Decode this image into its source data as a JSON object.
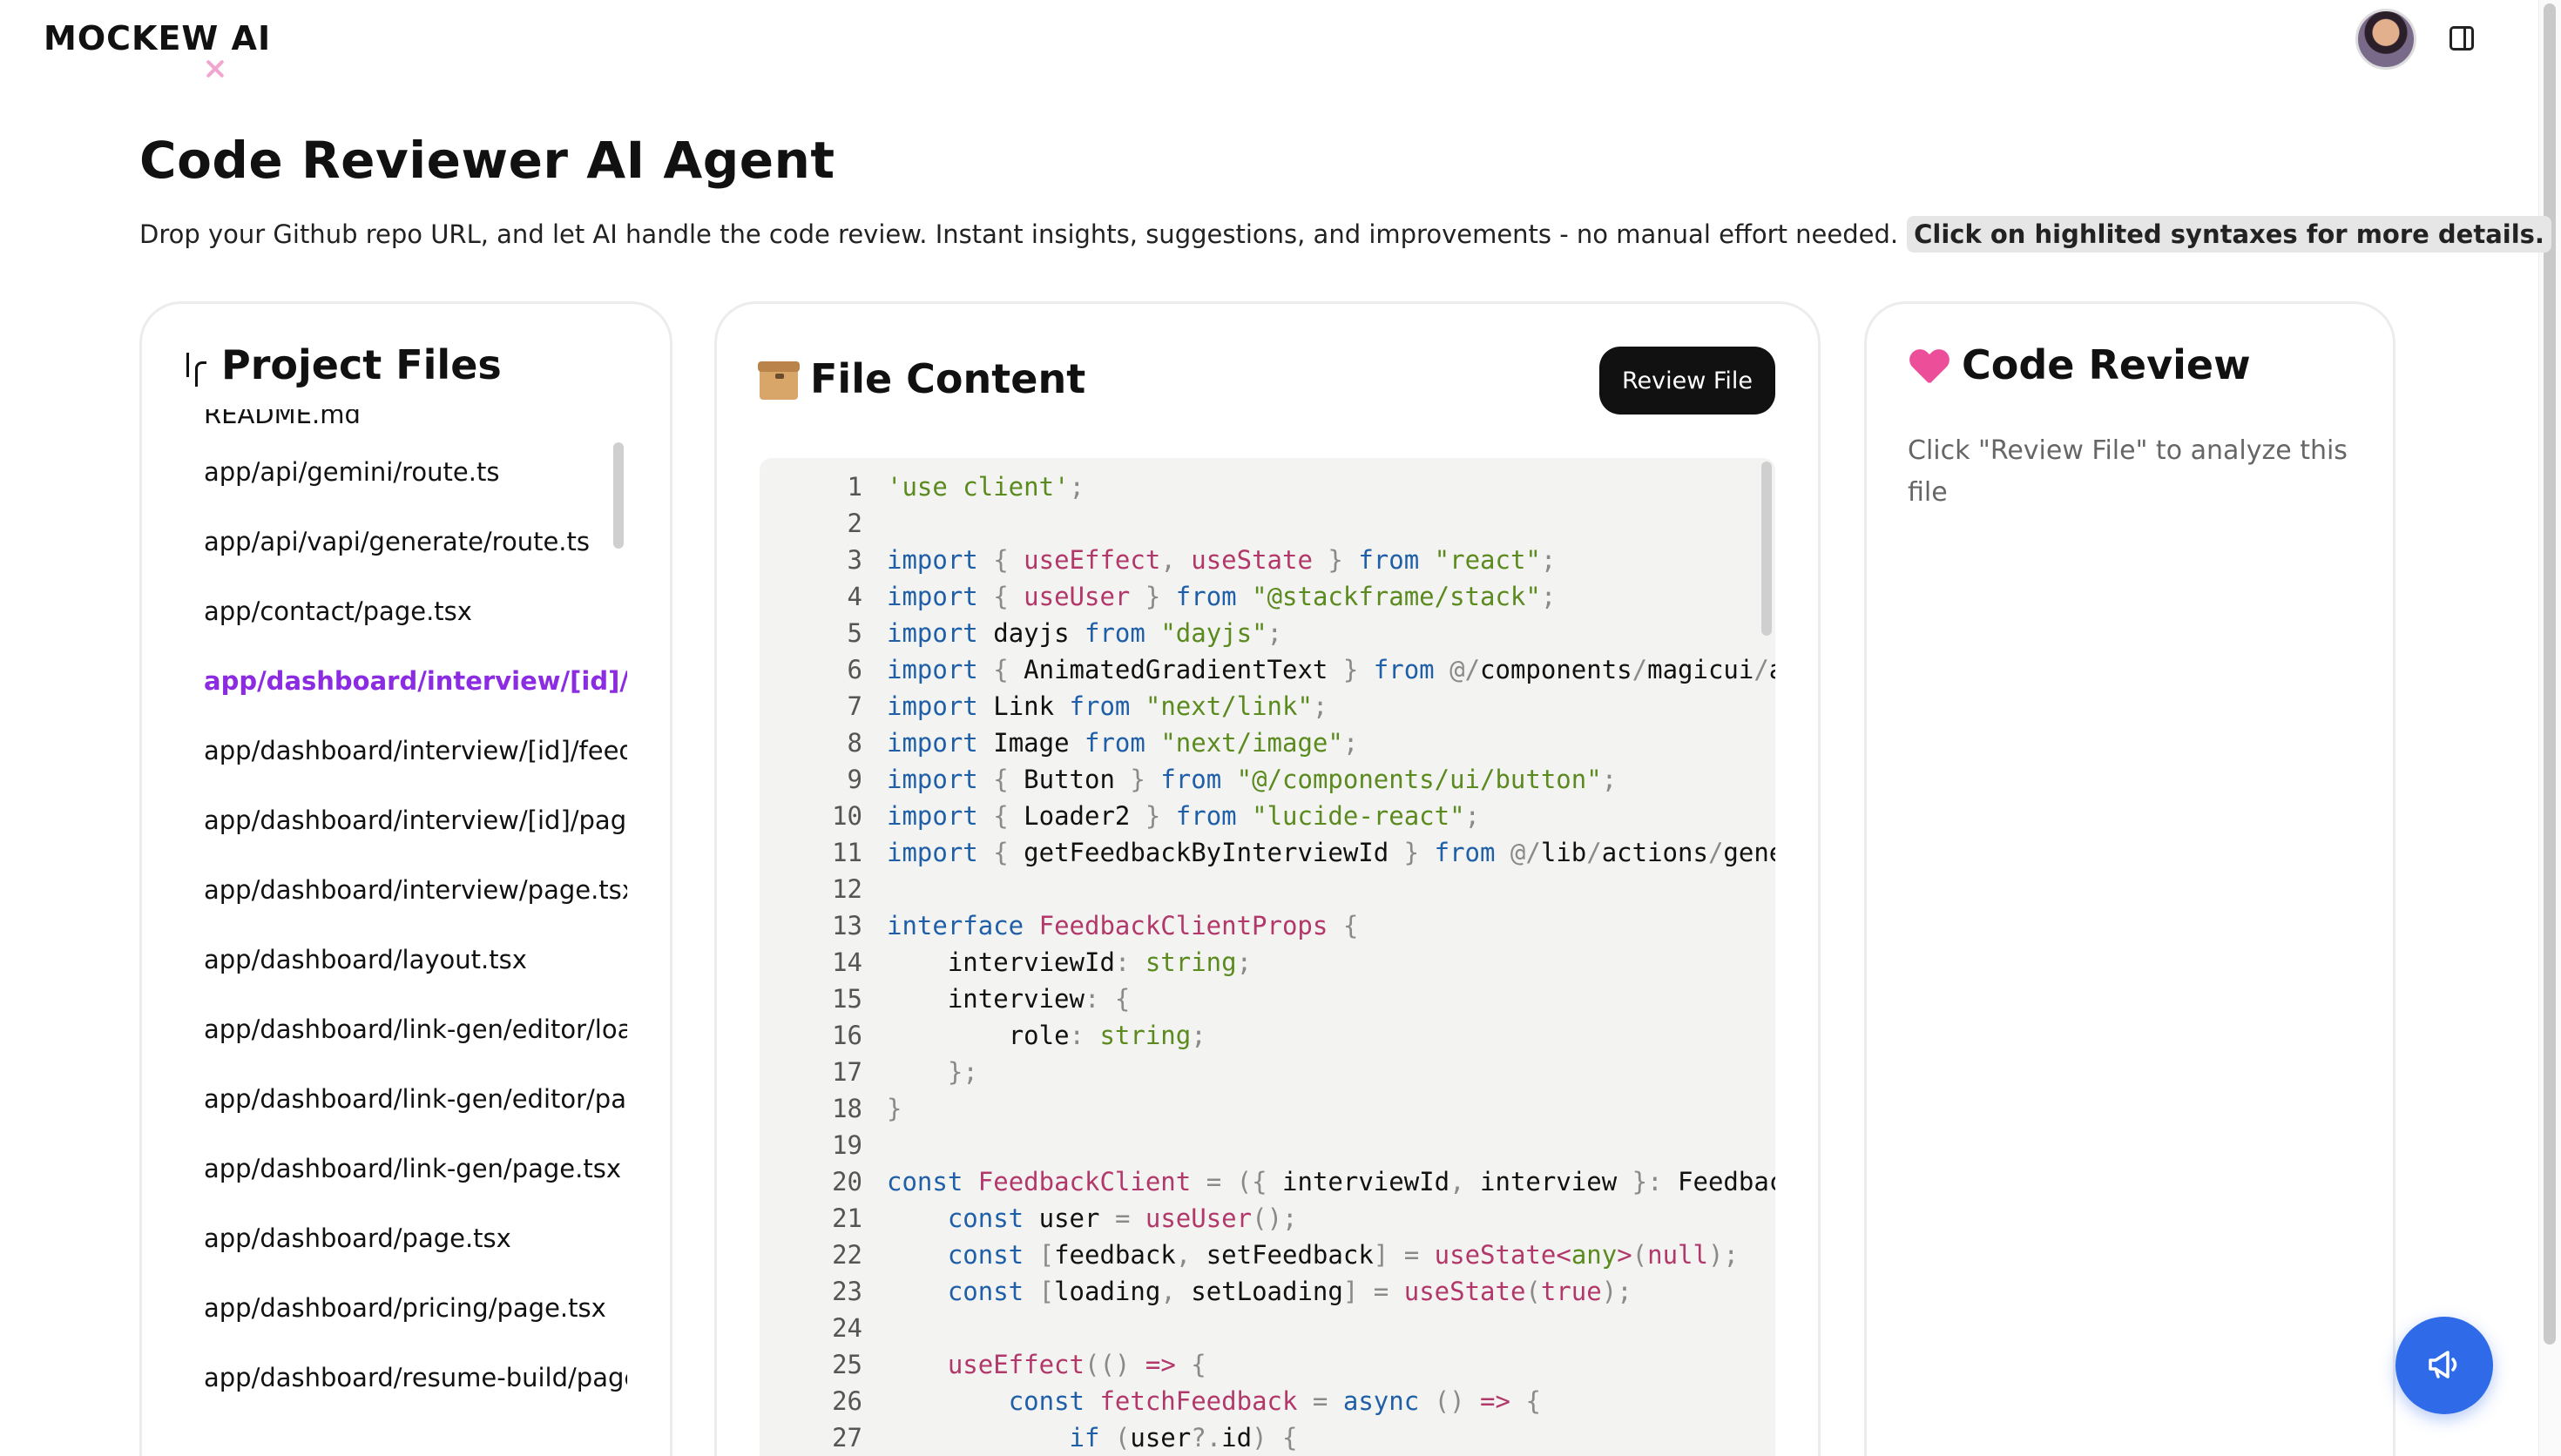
{
  "header": {
    "logo": "MOCKEW AI"
  },
  "page": {
    "title": "Code Reviewer AI Agent",
    "description": "Drop your Github repo URL, and let AI handle the code review. Instant insights, suggestions, and improvements - no manual effort needed.",
    "highlight_note": "Click on highlited syntaxes for more details."
  },
  "files_panel": {
    "title": "Project Files",
    "items": [
      "README.md",
      "app/api/gemini/route.ts",
      "app/api/vapi/generate/route.ts",
      "app/contact/page.tsx",
      "app/dashboard/interview/[id]/f",
      "app/dashboard/interview/[id]/feed",
      "app/dashboard/interview/[id]/page",
      "app/dashboard/interview/page.tsx",
      "app/dashboard/layout.tsx",
      "app/dashboard/link-gen/editor/loa",
      "app/dashboard/link-gen/editor/pag",
      "app/dashboard/link-gen/page.tsx",
      "app/dashboard/page.tsx",
      "app/dashboard/pricing/page.tsx",
      "app/dashboard/resume-build/page."
    ],
    "active_index": 4
  },
  "content_panel": {
    "title": "File Content",
    "review_button": "Review File",
    "line_numbers": [
      "1",
      "2",
      "3",
      "4",
      "5",
      "6",
      "7",
      "8",
      "9",
      "10",
      "11",
      "12",
      "13",
      "14",
      "15",
      "16",
      "17",
      "18",
      "19",
      "20",
      "21",
      "22",
      "23",
      "24",
      "25",
      "26",
      "27"
    ],
    "lines": [
      "'use client';",
      "",
      "import { useEffect, useState } from \"react\";",
      "import { useUser } from \"@stackframe/stack\";",
      "import dayjs from \"dayjs\";",
      "import { AnimatedGradientText } from \"@/components/magicui/ar",
      "import Link from \"next/link\";",
      "import Image from \"next/image\";",
      "import { Button } from \"@/components/ui/button\";",
      "import { Loader2 } from \"lucide-react\";",
      "import { getFeedbackByInterviewId } from \"@/lib/actions/gener",
      "",
      "interface FeedbackClientProps {",
      "    interviewId: string;",
      "    interview: {",
      "        role: string;",
      "    };",
      "}",
      "",
      "const FeedbackClient = ({ interviewId, interview }: FeedbackC",
      "    const user = useUser();",
      "    const [feedback, setFeedback] = useState<any>(null);",
      "    const [loading, setLoading] = useState(true);",
      "",
      "    useEffect(() => {",
      "        const fetchFeedback = async () => {",
      "            if (user?.id) {"
    ]
  },
  "review_panel": {
    "title": "Code Review",
    "placeholder": "Click \"Review File\" to analyze this file"
  },
  "colors": {
    "keyword": "#1f5fa8",
    "string": "#5b8a1f",
    "type": "#b2386a",
    "active_file": "#8b2be2",
    "fab": "#2f6be8"
  },
  "icons": {
    "files_title": "git-branch-icon",
    "content_title": "box-icon",
    "review_title": "sparkling-heart-icon",
    "fab": "megaphone-icon",
    "panel_toggle": "sidebar-panel-icon"
  }
}
